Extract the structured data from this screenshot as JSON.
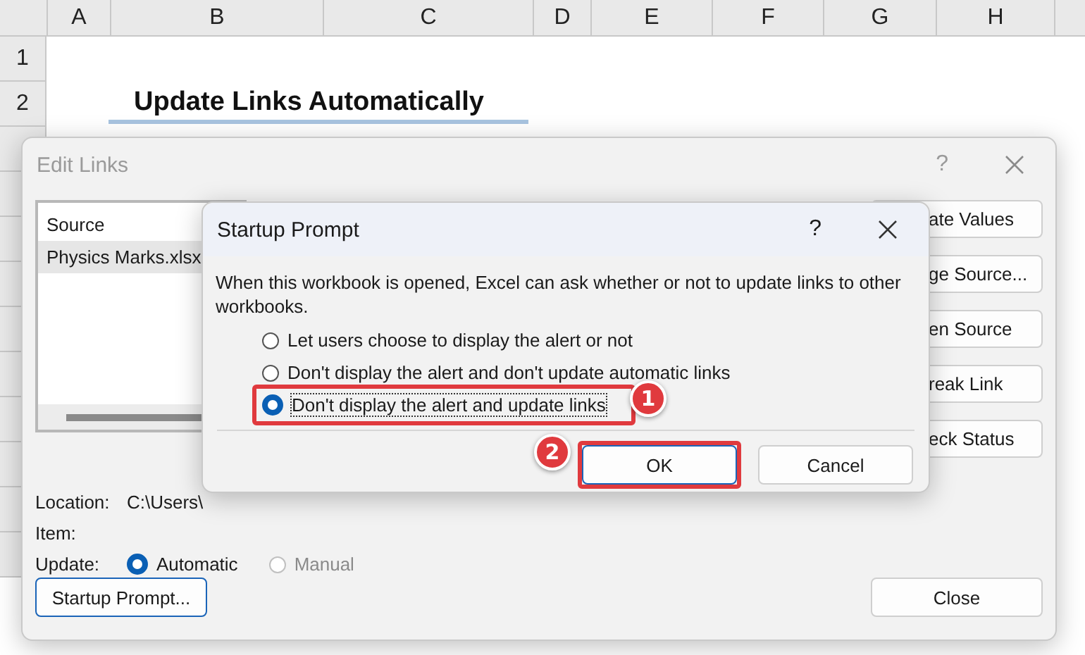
{
  "spreadsheet": {
    "columns": [
      "A",
      "B",
      "C",
      "D",
      "E",
      "F",
      "G",
      "H"
    ],
    "rows": [
      {
        "header": "1"
      },
      {
        "header": "2"
      }
    ],
    "title": "Update Links Automatically"
  },
  "edit_links": {
    "title": "Edit Links",
    "help": "?",
    "list": {
      "column": "Source",
      "items": [
        {
          "text": "Physics Marks.xlsx",
          "selected": true
        }
      ]
    },
    "buttons": [
      "ate Values",
      "ge Source...",
      "en Source",
      "reak Link",
      "eck Status"
    ],
    "location_label": "Location:",
    "location": "C:\\Users\\",
    "item_label": "Item:",
    "update_label": "Update:",
    "update_options": [
      {
        "label": "Automatic",
        "selected": true,
        "disabled": false
      },
      {
        "label": "Manual",
        "selected": false,
        "disabled": true
      }
    ],
    "startup_button": "Startup Prompt...",
    "close_button": "Close"
  },
  "startup_prompt": {
    "title": "Startup Prompt",
    "help": "?",
    "message": "When this workbook is opened, Excel can ask whether or not to update links to other workbooks.",
    "options": [
      {
        "label": "Let users choose to display the alert or not",
        "selected": false
      },
      {
        "label": "Don't display the alert and don't update automatic links",
        "selected": false
      },
      {
        "label": "Don't display the alert and update links",
        "selected": true
      }
    ],
    "ok": "OK",
    "cancel": "Cancel"
  },
  "annotations": [
    {
      "text": "1"
    },
    {
      "text": "2"
    }
  ]
}
